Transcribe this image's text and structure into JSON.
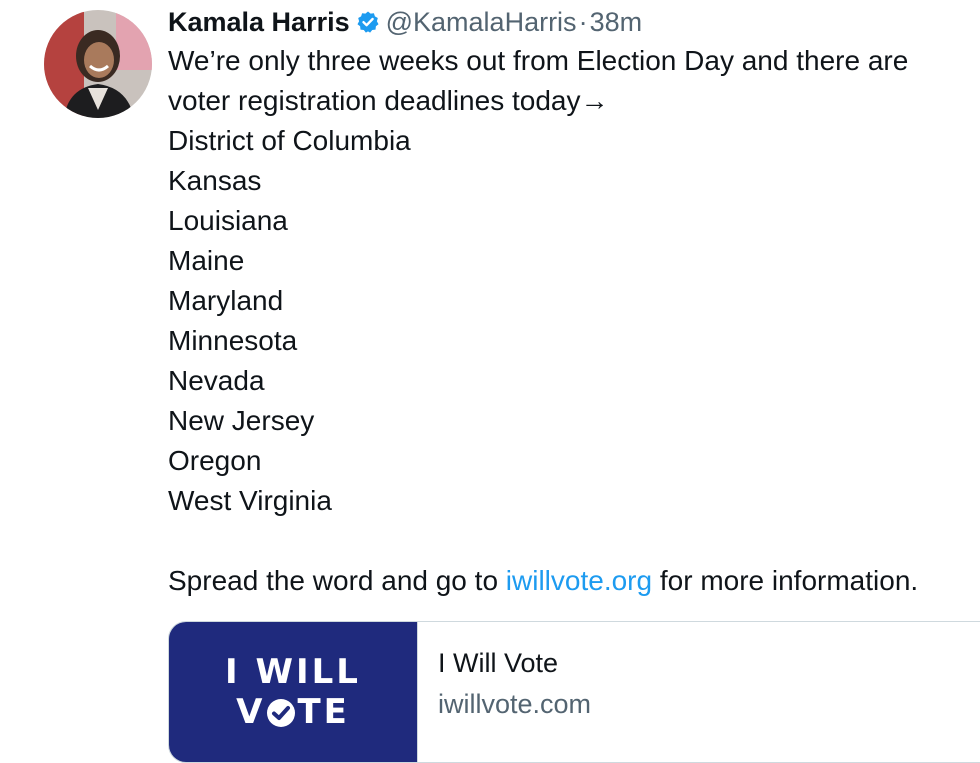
{
  "tweet": {
    "author_name": "Kamala Harris",
    "handle": "@KamalaHarris",
    "separator": "·",
    "timestamp": "38m",
    "verified": true,
    "lines": [
      "We’re only three weeks out from Election Day and there are",
      "voter registration deadlines today→",
      "District of Columbia",
      "Kansas",
      "Louisiana",
      "Maine",
      "Maryland",
      "Minnesota",
      "Nevada",
      "New Jersey",
      "Oregon",
      "West Virginia"
    ],
    "closing": {
      "before_link": "Spread the word and go to ",
      "link_text": "iwillvote.org",
      "after_link": " for more information."
    }
  },
  "card": {
    "logo_line1": "I WILL",
    "logo_line2_start": "V",
    "logo_line2_end": "TE",
    "title": "I Will Vote",
    "domain": "iwillvote.com"
  },
  "colors": {
    "link": "#1d9bf0",
    "card_logo_bg": "#1f2a7d",
    "verified_badge": "#1d9bf0"
  },
  "icons": {
    "verified": "verified-badge-icon",
    "checkmark_o": "check-circle-icon"
  }
}
